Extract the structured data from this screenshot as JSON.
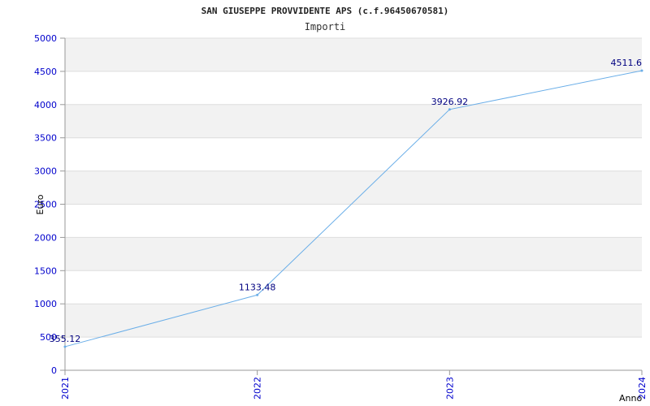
{
  "chart_data": {
    "type": "line",
    "title": "SAN GIUSEPPE PROVVIDENTE APS (c.f.96450670581)",
    "subtitle": "Importi",
    "xlabel": "Anno",
    "ylabel": "Euro",
    "categories": [
      "2021",
      "2022",
      "2023",
      "2024"
    ],
    "series": [
      {
        "values": [
          355.12,
          1133.48,
          3926.92,
          4511.6
        ],
        "labels": [
          "355.12",
          "1133.48",
          "3926.92",
          "4511.6"
        ]
      }
    ],
    "ylim": [
      0,
      5000
    ],
    "yticks": [
      "0",
      "500",
      "1000",
      "1500",
      "2000",
      "2500",
      "3000",
      "3500",
      "4000",
      "4500",
      "5000"
    ],
    "grid": true,
    "colors": {
      "line": "#6aaee8",
      "band": "#f2f2f2",
      "grid": "#dddddd",
      "tick_text": "#0000cc",
      "value_text": "#000080"
    }
  }
}
